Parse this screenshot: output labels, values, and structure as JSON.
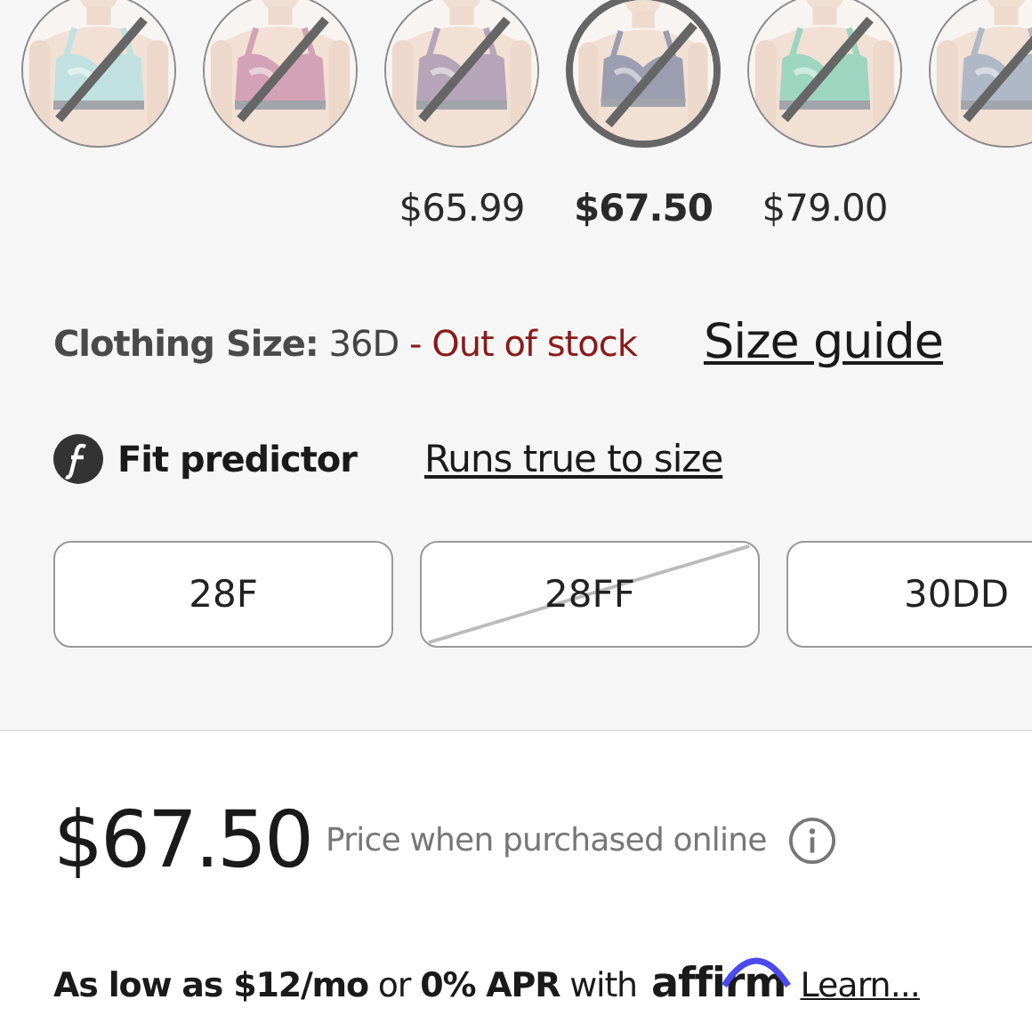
{
  "swatches": [
    {
      "selected": false,
      "available": false
    },
    {
      "selected": false,
      "available": false
    },
    {
      "selected": false,
      "available": false,
      "price": "$65.99"
    },
    {
      "selected": true,
      "available": false,
      "price": "$67.50"
    },
    {
      "selected": false,
      "available": false,
      "price": "$79.00"
    },
    {
      "selected": false,
      "available": false
    }
  ],
  "size_info": {
    "label": "Clothing Size:",
    "value": "36D",
    "status": "- Out of stock",
    "guide_link": "Size guide"
  },
  "fit_predictor": {
    "label": "Fit predictor",
    "result_link": "Runs true to size"
  },
  "sizes": [
    {
      "label": "28F",
      "available": true
    },
    {
      "label": "28FF",
      "available": false
    },
    {
      "label": "30DD",
      "available": true
    }
  ],
  "price": {
    "amount": "$67.50",
    "note": "Price when purchased online"
  },
  "financing": {
    "text": "**As low as $12/mo** or **0% APR** with",
    "logo": "affirm",
    "link": "Learn..."
  }
}
